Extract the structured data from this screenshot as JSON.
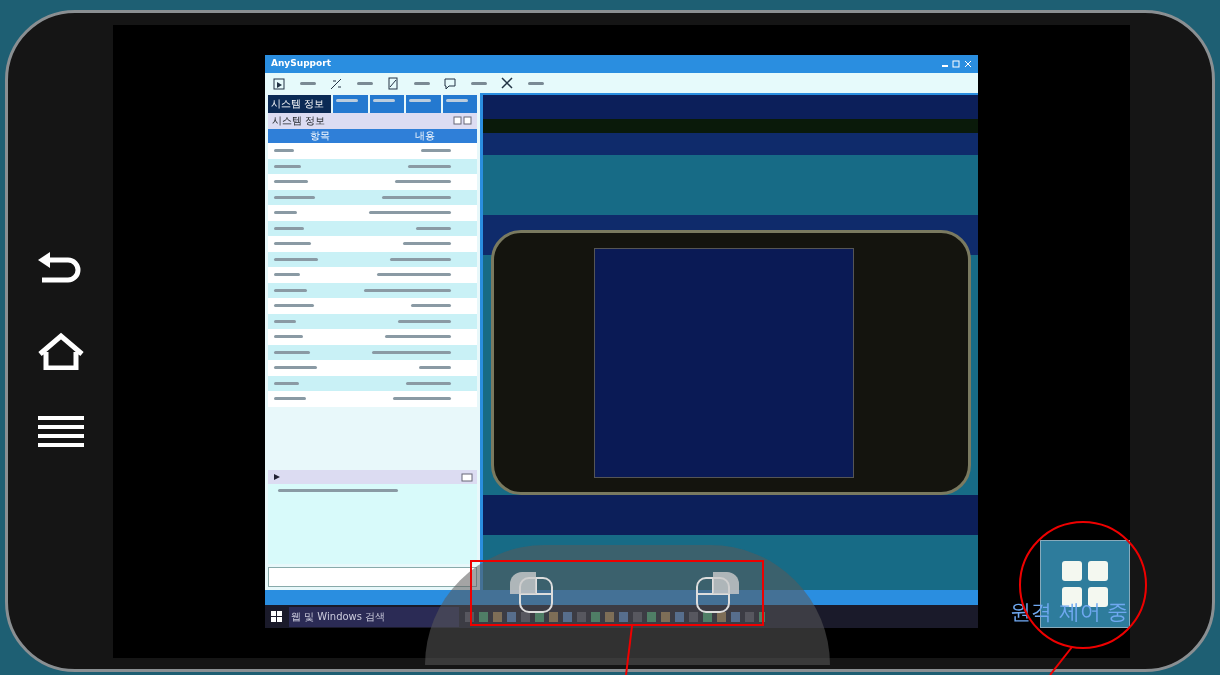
{
  "device": {
    "nav_buttons": [
      {
        "kind": "back"
      },
      {
        "kind": "home"
      },
      {
        "kind": "menu"
      }
    ]
  },
  "remote_window": {
    "title": "AnySupport",
    "toolbar": [
      {
        "kind": "capture"
      },
      {
        "kind": "pen"
      },
      {
        "kind": "draw"
      },
      {
        "kind": "chat"
      },
      {
        "kind": "tools"
      }
    ],
    "tabs": [
      {
        "label": "시스템 정보",
        "selected": true
      },
      {
        "selected": false
      },
      {
        "selected": false
      },
      {
        "selected": false
      },
      {
        "selected": false
      }
    ],
    "info_panel": {
      "title": "시스템 정보",
      "columns": [
        "항목",
        "내용"
      ],
      "rows": [
        {
          "shaded": false
        },
        {
          "shaded": true
        },
        {
          "shaded": false
        },
        {
          "shaded": true
        },
        {
          "shaded": false
        },
        {
          "shaded": true
        },
        {
          "shaded": false
        },
        {
          "shaded": true
        },
        {
          "shaded": false
        },
        {
          "shaded": true
        },
        {
          "shaded": false
        },
        {
          "shaded": true
        },
        {
          "shaded": false
        },
        {
          "shaded": true
        },
        {
          "shaded": false
        },
        {
          "shaded": true
        },
        {
          "shaded": false
        }
      ]
    }
  },
  "taskbar": {
    "search_placeholder": "웹 및 Windows 검색"
  },
  "remote_control_badge": {
    "label": "원격 제어 중"
  }
}
